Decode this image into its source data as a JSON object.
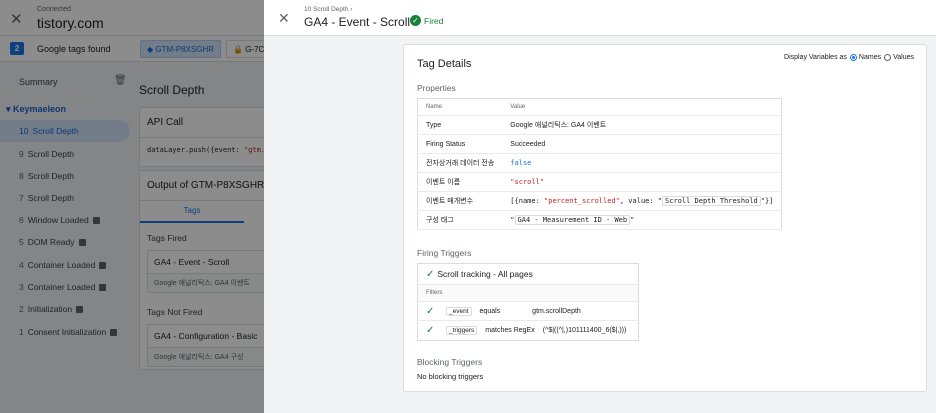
{
  "header": {
    "close_glyph": "✕",
    "connected_label": "Connected",
    "domain": "tistory.com"
  },
  "tagbar": {
    "count": "2",
    "found_label": "Google tags found",
    "chips": [
      "GTM-P8XSGHR",
      "G-7C"
    ]
  },
  "sidebar": {
    "summary_label": "Summary",
    "group_label": "Keymaeleon",
    "items": [
      {
        "num": "10",
        "label": "Scroll Depth",
        "active": true
      },
      {
        "num": "9",
        "label": "Scroll Depth"
      },
      {
        "num": "8",
        "label": "Scroll Depth"
      },
      {
        "num": "7",
        "label": "Scroll Depth"
      },
      {
        "num": "6",
        "label": "Window Loaded"
      },
      {
        "num": "5",
        "label": "DOM Ready"
      },
      {
        "num": "4",
        "label": "Container Loaded"
      },
      {
        "num": "3",
        "label": "Container Loaded"
      },
      {
        "num": "2",
        "label": "Initialization"
      },
      {
        "num": "1",
        "label": "Consent Initialization"
      }
    ]
  },
  "main": {
    "title": "Scroll Depth",
    "api_call_title": "API Call",
    "api_code_prefix": "dataLayer.push({event: ",
    "api_code_string": "\"gtm.sc",
    "output_title": "Output of GTM-P8XSGHR",
    "tab_label": "Tags",
    "tags_fired_label": "Tags Fired",
    "fired_tag_name": "GA4 - Event - Scroll",
    "fired_tag_type": "Google 애널리틱스: GA4 이벤트",
    "tags_not_fired_label": "Tags Not Fired",
    "not_fired_tag_name": "GA4 - Configuration - Basic",
    "not_fired_tag_type": "Google 애널리틱스: GA4 구성"
  },
  "drawer": {
    "close_glyph": "✕",
    "breadcrumb": "10 Scroll Depth  ›",
    "title": "GA4 - Event - Scroll",
    "status": "Fired",
    "details_title": "Tag Details",
    "display_vars_label": "Display Variables as",
    "opt_names": "Names",
    "opt_values": "Values",
    "properties_label": "Properties",
    "col_name": "Name",
    "col_value": "Value",
    "props": {
      "type_k": "Type",
      "type_v": "Google 애널리틱스: GA4 이벤트",
      "status_k": "Firing Status",
      "status_v": "Succeeded",
      "ecom_k": "전자상거래 데이터 전송",
      "ecom_v": "false",
      "event_k": "이벤트 이름",
      "event_v": "\"scroll\"",
      "params_k": "이벤트 매개변수",
      "params_v1": "[{name: ",
      "params_v2": "\"percent_scrolled\"",
      "params_v3": ", value: \"",
      "params_v4": "Scroll Depth Threshold",
      "params_v5": "\"}]",
      "tag_k": "구성 태그",
      "tag_v1": "\"",
      "tag_v2": "GA4 - Measurement ID - Web",
      "tag_v3": "\""
    },
    "firing_triggers_label": "Firing Triggers",
    "trigger_name": "Scroll tracking - All pages",
    "filters_label": "Filters",
    "filters": [
      {
        "var": "_event",
        "op": "equals",
        "val": "gtm.scrollDepth"
      },
      {
        "var": "_triggers",
        "op": "matches RegEx",
        "val": "(^$|((^|,)101111400_6($|,)))"
      }
    ],
    "blocking_triggers_label": "Blocking Triggers",
    "no_blocking": "No blocking triggers"
  },
  "colors": {
    "accent": "#1a73e8",
    "success": "#188038",
    "string": "#c5221f"
  }
}
